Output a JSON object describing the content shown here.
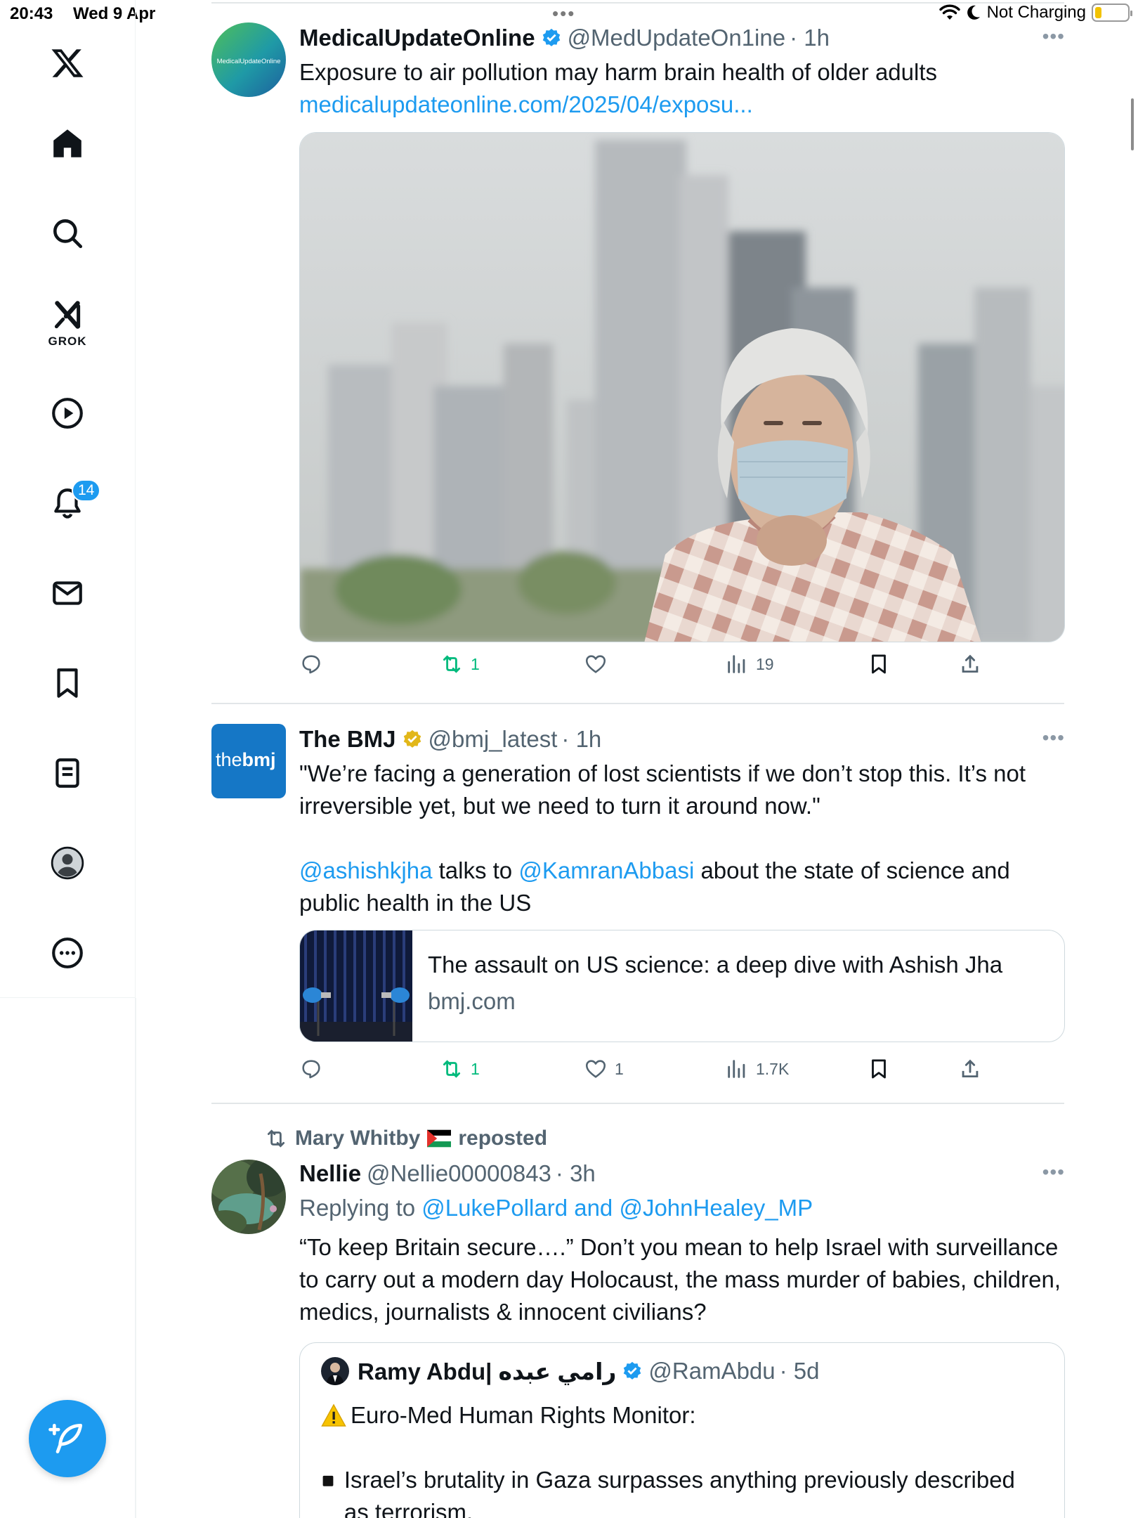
{
  "status_bar": {
    "time": "20:43",
    "date": "Wed 9 Apr",
    "dots": "•••",
    "charging": "Not Charging",
    "battery_level": 0.2
  },
  "sidebar": {
    "grok_label": "GROK",
    "notification_count": "14",
    "items": [
      "x-logo-icon",
      "home-icon",
      "search-icon",
      "grok-icon",
      "video-icon",
      "bell-icon",
      "mail-icon",
      "bookmark-icon",
      "list-icon",
      "profile-icon",
      "more-icon"
    ]
  },
  "colors": {
    "accent": "#1d9bf0",
    "retweet": "#00ba7c",
    "muted": "#536471",
    "gold": "#e2b719"
  },
  "tweets": [
    {
      "avatar_text": "MedicalUpdateOnline",
      "name": "MedicalUpdateOnline",
      "handle": "@MedUpdateOn1ine",
      "time": "· 1h",
      "text": "Exposure to air pollution may harm brain health of older adults",
      "link": "medicalupdateonline.com/2025/04/exposu...",
      "stats": {
        "replies": "",
        "retweets": "1",
        "likes": "",
        "views": "19"
      }
    },
    {
      "avatar_text_1": "the",
      "avatar_text_2": "bmj",
      "name": "The BMJ",
      "handle": "@bmj_latest",
      "time": "· 1h",
      "text_1": "\"We’re facing a generation of lost scientists if we don’t stop this. It’s not irreversible yet, but we need to turn it around now.\"",
      "mention_1": "@ashishkjha",
      "text_2": " talks to ",
      "mention_2": "@KamranAbbasi",
      "text_3": " about the state of science and public health in the US",
      "card_title": "The assault on US science: a deep dive with Ashish Jha",
      "card_domain": "bmj.com",
      "stats": {
        "replies": "",
        "retweets": "1",
        "likes": "1",
        "views": "1.7K"
      }
    },
    {
      "repost_by": "Mary Whitby",
      "repost_label": "reposted",
      "name": "Nellie",
      "handle": "@Nellie00000843",
      "time": "· 3h",
      "replying_label": "Replying to ",
      "replying_to": "@LukePollard and @JohnHealey_MP",
      "text": "“To keep Britain secure….” Don’t you mean to help Israel with surveillance to carry out a modern day Holocaust, the mass murder of babies, children, medics, journalists & innocent civilians?",
      "quote": {
        "name": "Ramy Abdu| رامي عبده",
        "handle": "@RamAbdu",
        "time": "· 5d",
        "line_1": "Euro-Med Human Rights Monitor:",
        "line_2": "Israel’s brutality in Gaza surpasses anything previously described as terrorism."
      }
    }
  ]
}
